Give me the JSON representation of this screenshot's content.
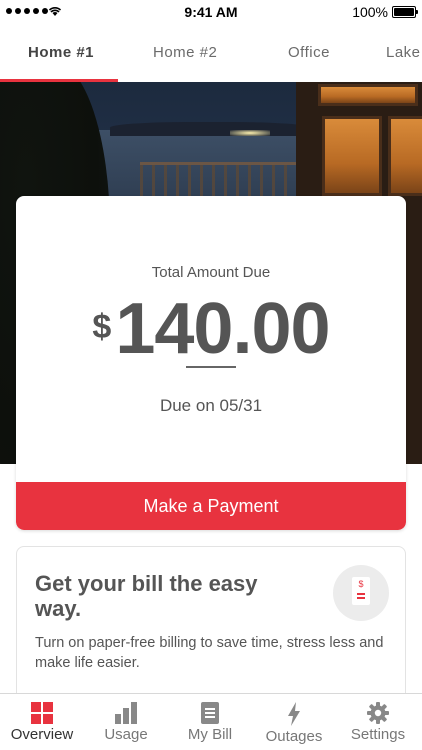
{
  "status_bar": {
    "time": "9:41 AM",
    "battery": "100%"
  },
  "tabs": [
    {
      "label": "Home #1",
      "active": true
    },
    {
      "label": "Home #2",
      "active": false
    },
    {
      "label": "Office",
      "active": false
    },
    {
      "label": "Lake",
      "active": false
    }
  ],
  "bill": {
    "label": "Total Amount Due",
    "currency": "$",
    "amount": "140.00",
    "due": "Due on 05/31",
    "pay_button": "Make a Payment"
  },
  "promo": {
    "title": "Get your bill the easy way.",
    "text": "Turn on paper-free billing to save time, stress less and make life easier.",
    "icon": "paper-bill-icon"
  },
  "nav": [
    {
      "label": "Overview",
      "icon": "overview-grid-icon",
      "active": true
    },
    {
      "label": "Usage",
      "icon": "usage-bars-icon",
      "active": false
    },
    {
      "label": "My Bill",
      "icon": "bill-document-icon",
      "active": false
    },
    {
      "label": "Outages",
      "icon": "lightning-icon",
      "active": false
    },
    {
      "label": "Settings",
      "icon": "gear-icon",
      "active": false
    }
  ],
  "colors": {
    "accent": "#e8333f",
    "text": "#555555",
    "icon_inactive": "#888888"
  }
}
